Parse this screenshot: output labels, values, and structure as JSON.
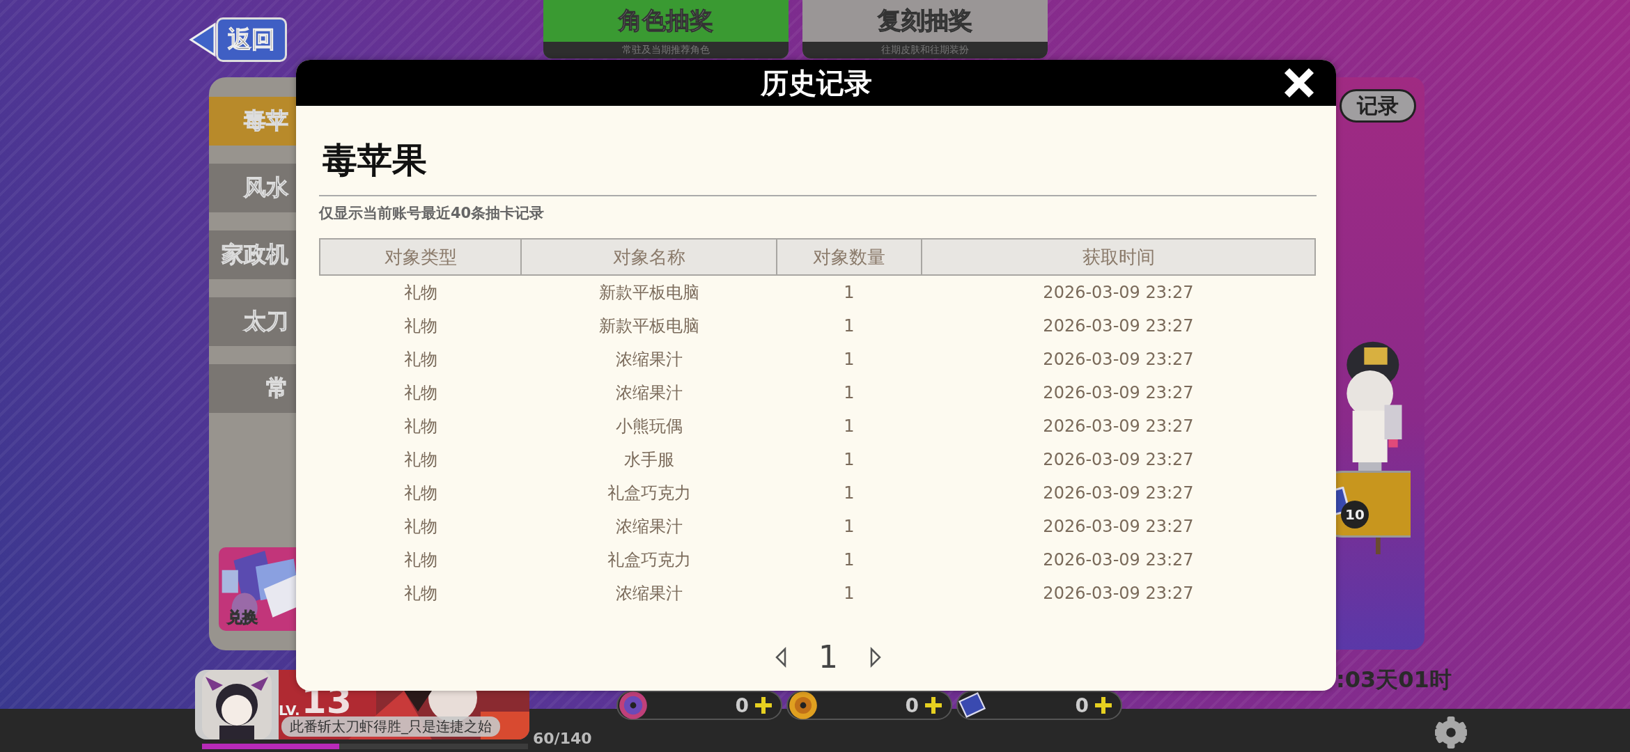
{
  "back_button": {
    "label": "返回"
  },
  "top_tabs": [
    {
      "label": "角色抽奖",
      "subtitle": "常驻及当期推荐角色",
      "selected": true
    },
    {
      "label": "复刻抽奖",
      "subtitle": "往期皮肤和往期装扮",
      "selected": false
    }
  ],
  "sidebar": {
    "items": [
      {
        "label": "毒苹",
        "selected": true
      },
      {
        "label": "风水",
        "selected": false
      },
      {
        "label": "家政机",
        "selected": false
      },
      {
        "label": "太刀",
        "selected": false
      },
      {
        "label": "常",
        "selected": false
      }
    ],
    "exchange_label": "兑换"
  },
  "right_panel": {
    "record_button": "记录",
    "ticket_count": "10",
    "timer": ":03天01时"
  },
  "player": {
    "level_prefix": "LV.",
    "level": "13",
    "title": "此番斩太刀虾得胜_只是连捷之始",
    "exp": "60/140",
    "exp_bar": {
      "level": 0.42
    }
  },
  "currencies": [
    {
      "kind": "pink-disc",
      "amount": "0"
    },
    {
      "kind": "gold-disc",
      "amount": "0"
    },
    {
      "kind": "ticket",
      "amount": "0"
    }
  ],
  "modal": {
    "title": "历史记录",
    "pool_name": "毒苹果",
    "note": "仅显示当前账号最近40条抽卡记录",
    "columns": [
      "对象类型",
      "对象名称",
      "对象数量",
      "获取时间"
    ],
    "rows": [
      [
        "礼物",
        "新款平板电脑",
        "1",
        "2026-03-09 23:27"
      ],
      [
        "礼物",
        "新款平板电脑",
        "1",
        "2026-03-09 23:27"
      ],
      [
        "礼物",
        "浓缩果汁",
        "1",
        "2026-03-09 23:27"
      ],
      [
        "礼物",
        "浓缩果汁",
        "1",
        "2026-03-09 23:27"
      ],
      [
        "礼物",
        "小熊玩偶",
        "1",
        "2026-03-09 23:27"
      ],
      [
        "礼物",
        "水手服",
        "1",
        "2026-03-09 23:27"
      ],
      [
        "礼物",
        "礼盒巧克力",
        "1",
        "2026-03-09 23:27"
      ],
      [
        "礼物",
        "浓缩果汁",
        "1",
        "2026-03-09 23:27"
      ],
      [
        "礼物",
        "礼盒巧克力",
        "1",
        "2026-03-09 23:27"
      ],
      [
        "礼物",
        "浓缩果汁",
        "1",
        "2026-03-09 23:27"
      ]
    ],
    "pagination": {
      "page": "1"
    }
  }
}
